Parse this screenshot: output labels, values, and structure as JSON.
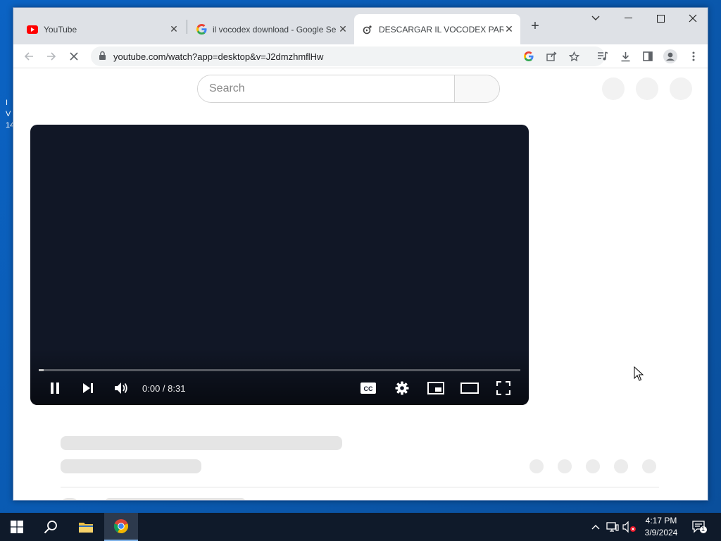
{
  "desktop": {
    "text_fragment_1": "I",
    "text_fragment_2": "V",
    "text_fragment_3": "14"
  },
  "tabs": [
    {
      "title": "YouTube",
      "icon": "youtube-icon"
    },
    {
      "title": "il vocodex download - Google Se",
      "icon": "google-icon"
    },
    {
      "title": "DESCARGAR IL VOCODEX PARA",
      "icon": "youtube-shorts-icon",
      "active": true
    }
  ],
  "toolbar": {
    "url": "youtube.com/watch?app=desktop&v=J2dmzhmflHw"
  },
  "page": {
    "search_placeholder": "Search",
    "player": {
      "time": "0:00 / 8:31",
      "progress": 0.01
    }
  },
  "taskbar": {
    "time": "4:17 PM",
    "date": "3/9/2024",
    "notification_count": "1"
  },
  "colors": {
    "player_bg": "#111726",
    "tab_strip": "#dee1e6",
    "taskbar": "#0f1a2a"
  }
}
